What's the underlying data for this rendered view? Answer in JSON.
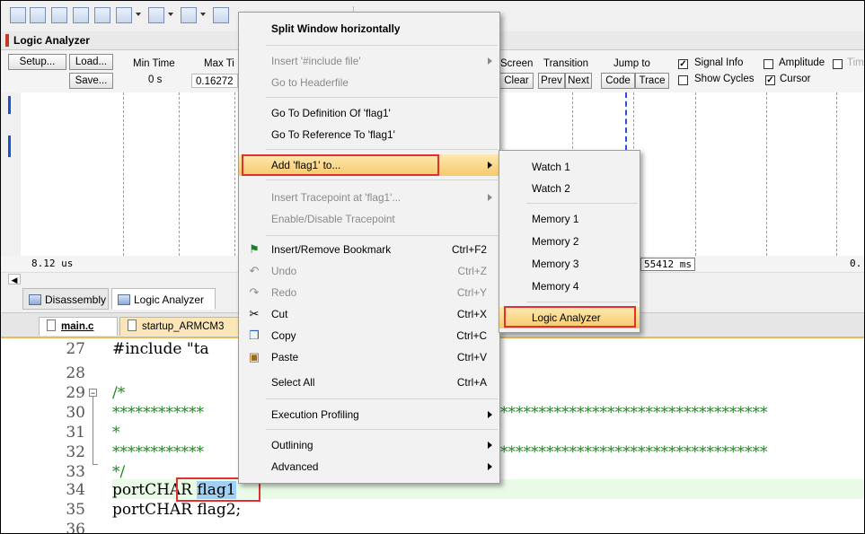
{
  "logic_analyzer": {
    "title": "Logic Analyzer",
    "setup_label": "Setup...",
    "load_label": "Load...",
    "save_label": "Save...",
    "min_time_label": "Min Time",
    "min_time_value": "0 s",
    "max_time_label": "Max Ti",
    "max_time_value": "0.16272",
    "screen_label": "Screen",
    "clear_label": "Clear",
    "transition_label": "Transition",
    "prev_label": "Prev",
    "next_label": "Next",
    "jump_to_label": "Jump to",
    "code_label": "Code",
    "trace_label": "Trace",
    "signal_info_label": "Signal Info",
    "amplitude_label": "Amplitude",
    "tim_label": "Tim",
    "show_cycles_label": "Show Cycles",
    "cursor_label": "Cursor",
    "time_left": "8.12 us",
    "time_cursor": "55412 ms",
    "time_right": "0."
  },
  "tabs": {
    "disassembly": "Disassembly",
    "logic_analyzer": "Logic Analyzer"
  },
  "editor": {
    "tab_main": "main.c",
    "tab_startup": "startup_ARMCM3",
    "lines": [
      {
        "n": "27",
        "code": "#include \"ta"
      },
      {
        "n": "28",
        "code": ""
      },
      {
        "n": "29",
        "code": "/*"
      },
      {
        "n": "30",
        "code": "************"
      },
      {
        "n": "31",
        "code": "*"
      },
      {
        "n": "32",
        "code": "************"
      },
      {
        "n": "33",
        "code": "*/"
      },
      {
        "n": "34",
        "code": "portCHAR "
      },
      {
        "n": "35",
        "code": "portCHAR flag2;"
      },
      {
        "n": "36",
        "code": ""
      }
    ],
    "line30_tail": "***********************************",
    "line32_tail": "***********************************",
    "selected_word": "flag1"
  },
  "context_menu": {
    "split_window": "Split Window horizontally",
    "insert_include": "Insert '#include file'",
    "go_to_headerfile": "Go to Headerfile",
    "go_to_definition": "Go To Definition Of 'flag1'",
    "go_to_reference": "Go To Reference To 'flag1'",
    "add_to": "Add 'flag1' to...",
    "insert_tracepoint": "Insert Tracepoint at 'flag1'...",
    "enable_disable_tracepoint": "Enable/Disable Tracepoint",
    "insert_remove_bookmark": "Insert/Remove Bookmark",
    "insert_remove_bookmark_key": "Ctrl+F2",
    "undo": "Undo",
    "undo_key": "Ctrl+Z",
    "redo": "Redo",
    "redo_key": "Ctrl+Y",
    "cut": "Cut",
    "cut_key": "Ctrl+X",
    "copy": "Copy",
    "copy_key": "Ctrl+C",
    "paste": "Paste",
    "paste_key": "Ctrl+V",
    "select_all": "Select All",
    "select_all_key": "Ctrl+A",
    "execution_profiling": "Execution Profiling",
    "outlining": "Outlining",
    "advanced": "Advanced"
  },
  "submenu": {
    "watch1": "Watch 1",
    "watch2": "Watch 2",
    "memory1": "Memory 1",
    "memory2": "Memory 2",
    "memory3": "Memory 3",
    "memory4": "Memory 4",
    "logic_analyzer": "Logic Analyzer"
  },
  "colors": {
    "highlight_box": "#e03030",
    "menu_highlight": "#f7c96b",
    "selection": "#9fd0f5"
  }
}
